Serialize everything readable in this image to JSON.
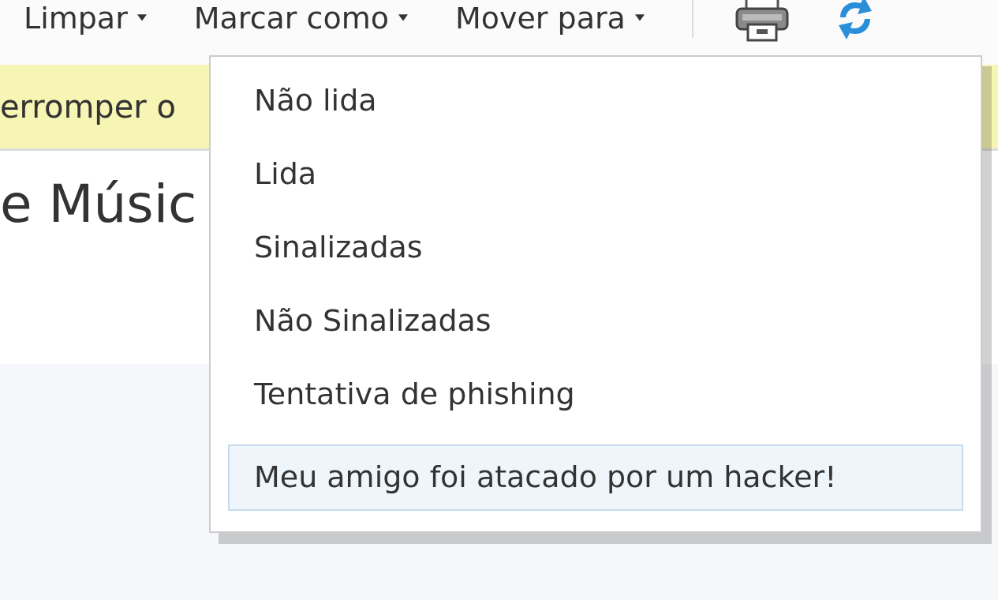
{
  "toolbar": {
    "buttons": [
      {
        "label": "Limpar",
        "dropdown": true
      },
      {
        "label": "Marcar como",
        "dropdown": true
      },
      {
        "label": "Mover para",
        "dropdown": true
      }
    ]
  },
  "banner": {
    "text": "erromper o"
  },
  "message": {
    "title": "e Músic"
  },
  "menu": {
    "items": [
      {
        "label": "Não lida",
        "selected": false
      },
      {
        "label": "Lida",
        "selected": false
      },
      {
        "label": "Sinalizadas",
        "selected": false
      },
      {
        "label": "Não Sinalizadas",
        "selected": false
      },
      {
        "label": "Tentativa de phishing",
        "selected": false
      },
      {
        "label": "Meu amigo foi atacado por um hacker!",
        "selected": true
      }
    ]
  }
}
